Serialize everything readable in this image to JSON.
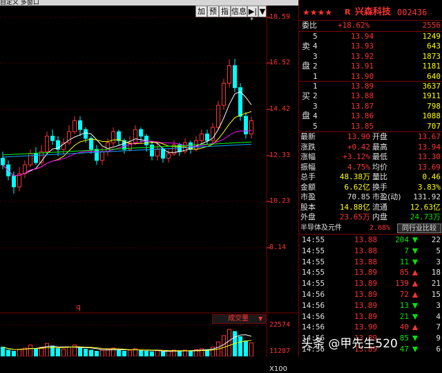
{
  "menu": {
    "text": "自定义  多窗口"
  },
  "toolbar": {
    "buttons": [
      "加",
      "预",
      "指",
      "信息",
      "▶|",
      "▼"
    ]
  },
  "chart": {
    "price_labels": [
      "18.59",
      "16.52",
      "14.42",
      "12.33",
      "10.23",
      "8.14"
    ],
    "q_marker": "q",
    "star_marker": "*",
    "volume_title": "成交量",
    "volume_labels": [
      "22574",
      "11287",
      "X100"
    ],
    "candles": [
      {
        "o": 12.2,
        "c": 11.9,
        "h": 12.5,
        "l": 11.7
      },
      {
        "o": 11.9,
        "c": 11.4,
        "h": 12.1,
        "l": 11.2
      },
      {
        "o": 11.4,
        "c": 10.9,
        "h": 11.6,
        "l": 10.6
      },
      {
        "o": 10.9,
        "c": 11.5,
        "h": 11.8,
        "l": 10.7
      },
      {
        "o": 11.5,
        "c": 11.9,
        "h": 12.1,
        "l": 11.3
      },
      {
        "o": 11.9,
        "c": 12.4,
        "h": 12.6,
        "l": 11.8
      },
      {
        "o": 12.4,
        "c": 12.0,
        "h": 12.7,
        "l": 11.9
      },
      {
        "o": 12.0,
        "c": 12.5,
        "h": 12.8,
        "l": 11.9
      },
      {
        "o": 12.5,
        "c": 13.2,
        "h": 13.4,
        "l": 12.4
      },
      {
        "o": 13.2,
        "c": 13.0,
        "h": 13.5,
        "l": 12.8
      },
      {
        "o": 13.0,
        "c": 12.6,
        "h": 13.2,
        "l": 12.3
      },
      {
        "o": 12.6,
        "c": 12.9,
        "h": 13.1,
        "l": 12.4
      },
      {
        "o": 12.9,
        "c": 13.4,
        "h": 13.7,
        "l": 12.8
      },
      {
        "o": 13.4,
        "c": 13.9,
        "h": 14.1,
        "l": 13.3
      },
      {
        "o": 13.9,
        "c": 13.5,
        "h": 14.1,
        "l": 13.2
      },
      {
        "o": 13.5,
        "c": 13.1,
        "h": 13.6,
        "l": 12.9
      },
      {
        "o": 13.1,
        "c": 12.6,
        "h": 13.2,
        "l": 12.4
      },
      {
        "o": 12.6,
        "c": 12.1,
        "h": 12.8,
        "l": 11.9
      },
      {
        "o": 12.1,
        "c": 12.5,
        "h": 12.7,
        "l": 11.9
      },
      {
        "o": 12.5,
        "c": 12.9,
        "h": 13.1,
        "l": 12.3
      },
      {
        "o": 12.9,
        "c": 13.4,
        "h": 13.6,
        "l": 12.7
      },
      {
        "o": 13.4,
        "c": 13.0,
        "h": 13.5,
        "l": 12.8
      },
      {
        "o": 13.0,
        "c": 12.6,
        "h": 13.1,
        "l": 12.4
      },
      {
        "o": 12.6,
        "c": 12.9,
        "h": 13.2,
        "l": 12.5
      },
      {
        "o": 12.9,
        "c": 13.5,
        "h": 13.7,
        "l": 12.8
      },
      {
        "o": 13.5,
        "c": 13.2,
        "h": 13.6,
        "l": 12.9
      },
      {
        "o": 13.2,
        "c": 12.8,
        "h": 13.3,
        "l": 12.5
      },
      {
        "o": 12.8,
        "c": 12.3,
        "h": 12.9,
        "l": 12.1
      },
      {
        "o": 12.3,
        "c": 12.6,
        "h": 12.9,
        "l": 12.1
      },
      {
        "o": 12.6,
        "c": 12.2,
        "h": 12.7,
        "l": 12.0
      },
      {
        "o": 12.2,
        "c": 12.4,
        "h": 12.6,
        "l": 12.0
      },
      {
        "o": 12.4,
        "c": 12.8,
        "h": 13.0,
        "l": 12.3
      },
      {
        "o": 12.8,
        "c": 12.5,
        "h": 12.9,
        "l": 12.3
      },
      {
        "o": 12.5,
        "c": 12.9,
        "h": 13.1,
        "l": 12.4
      },
      {
        "o": 12.9,
        "c": 12.6,
        "h": 13.0,
        "l": 12.4
      },
      {
        "o": 12.6,
        "c": 13.0,
        "h": 13.2,
        "l": 12.5
      },
      {
        "o": 13.0,
        "c": 13.3,
        "h": 13.5,
        "l": 12.8
      },
      {
        "o": 13.3,
        "c": 13.0,
        "h": 13.5,
        "l": 12.8
      },
      {
        "o": 13.0,
        "c": 13.6,
        "h": 13.8,
        "l": 12.9
      },
      {
        "o": 13.6,
        "c": 14.6,
        "h": 14.8,
        "l": 13.5
      },
      {
        "o": 14.6,
        "c": 15.6,
        "h": 15.8,
        "l": 14.4
      },
      {
        "o": 15.6,
        "c": 16.4,
        "h": 16.7,
        "l": 15.4
      },
      {
        "o": 16.4,
        "c": 15.4,
        "h": 16.7,
        "l": 15.2
      },
      {
        "o": 15.4,
        "c": 14.1,
        "h": 15.6,
        "l": 13.9
      },
      {
        "o": 14.1,
        "c": 13.3,
        "h": 14.3,
        "l": 13.1
      },
      {
        "o": 13.3,
        "c": 13.9,
        "h": 14.1,
        "l": 13.1
      }
    ],
    "volumes": [
      18,
      12,
      10,
      14,
      16,
      22,
      15,
      18,
      25,
      20,
      15,
      14,
      18,
      22,
      16,
      14,
      12,
      10,
      12,
      14,
      16,
      12,
      10,
      12,
      15,
      12,
      10,
      9,
      11,
      9,
      10,
      12,
      10,
      12,
      11,
      13,
      15,
      13,
      18,
      28,
      40,
      52,
      48,
      38,
      30,
      26
    ]
  },
  "stock": {
    "stars": "★★★★",
    "r_mark": "R",
    "name": "兴森科技",
    "code": "002436"
  },
  "order_book": {
    "webi_label": "委比",
    "webi_value": "+18.62%",
    "webi_diff": "2556",
    "sell_label_1": "卖",
    "sell_label_2": "盘",
    "buy_label_1": "买",
    "buy_label_2": "盘",
    "sells": [
      {
        "lvl": "5",
        "price": "13.94",
        "vol": "1249"
      },
      {
        "lvl": "4",
        "price": "13.93",
        "vol": "643"
      },
      {
        "lvl": "3",
        "price": "13.92",
        "vol": "1873"
      },
      {
        "lvl": "2",
        "price": "13.91",
        "vol": "1181"
      },
      {
        "lvl": "1",
        "price": "13.90",
        "vol": "640"
      }
    ],
    "buys": [
      {
        "lvl": "1",
        "price": "13.89",
        "vol": "3637"
      },
      {
        "lvl": "2",
        "price": "13.88",
        "vol": "1911"
      },
      {
        "lvl": "3",
        "price": "13.87",
        "vol": "798"
      },
      {
        "lvl": "4",
        "price": "13.86",
        "vol": "1088"
      },
      {
        "lvl": "5",
        "price": "13.85",
        "vol": "707"
      }
    ]
  },
  "stats": [
    {
      "l1": "最新",
      "v1": "13.90",
      "c1": "red",
      "l2": "开盘",
      "v2": "13.67",
      "c2": "red"
    },
    {
      "l1": "涨跌",
      "v1": "+0.42",
      "c1": "red",
      "l2": "最高",
      "v2": "13.94",
      "c2": "red"
    },
    {
      "l1": "涨幅",
      "v1": "+3.12%",
      "c1": "red",
      "l2": "最低",
      "v2": "13.30",
      "c2": "red"
    },
    {
      "l1": "振幅",
      "v1": "4.75%",
      "c1": "red",
      "l2": "均价",
      "v2": "13.69",
      "c2": "red"
    },
    {
      "l1": "总手",
      "v1": "48.38万",
      "c1": "yellow",
      "l2": "量比",
      "v2": "0.46",
      "c2": "yellow"
    },
    {
      "l1": "金额",
      "v1": "6.62亿",
      "c1": "yellow",
      "l2": "换手",
      "v2": "3.83%",
      "c2": "yellow"
    },
    {
      "l1": "市盈",
      "v1": "70.85",
      "c1": "white",
      "l2": "市盈(动)",
      "v2": "131.92",
      "c2": "white"
    },
    {
      "l1": "股本",
      "v1": "14.88亿",
      "c1": "yellow",
      "l2": "流通",
      "v2": "12.63亿",
      "c2": "yellow"
    },
    {
      "l1": "外盘",
      "v1": "23.65万",
      "c1": "red",
      "l2": "内盘",
      "v2": "24.73万",
      "c2": "green"
    }
  ],
  "industry": {
    "name": "半导体及元件",
    "change": "2.68%",
    "compare_button": "同行业比较"
  },
  "ticks": [
    {
      "time": "14:55",
      "price": "13.88",
      "pc": "red",
      "vol": "204",
      "vc": "green",
      "dir": "down",
      "n": "22"
    },
    {
      "time": "14:55",
      "price": "13.88",
      "pc": "red",
      "vol": "7",
      "vc": "green",
      "dir": "down",
      "n": "5"
    },
    {
      "time": "14:55",
      "price": "13.88",
      "pc": "red",
      "vol": "11",
      "vc": "green",
      "dir": "down",
      "n": "3"
    },
    {
      "time": "14:55",
      "price": "13.89",
      "pc": "red",
      "vol": "85",
      "vc": "red",
      "dir": "up",
      "n": "18"
    },
    {
      "time": "14:55",
      "price": "13.89",
      "pc": "red",
      "vol": "139",
      "vc": "red",
      "dir": "up",
      "n": "21"
    },
    {
      "time": "14:56",
      "price": "13.89",
      "pc": "red",
      "vol": "72",
      "vc": "red",
      "dir": "up",
      "n": "15"
    },
    {
      "time": "14:56",
      "price": "13.89",
      "pc": "red",
      "vol": "13",
      "vc": "green",
      "dir": "down",
      "n": "3"
    },
    {
      "time": "14:56",
      "price": "13.89",
      "pc": "red",
      "vol": "21",
      "vc": "green",
      "dir": "down",
      "n": "4"
    },
    {
      "time": "14:56",
      "price": "13.90",
      "pc": "red",
      "vol": "40",
      "vc": "red",
      "dir": "up",
      "n": "7"
    },
    {
      "time": "14:56",
      "price": "13.89",
      "pc": "red",
      "vol": "85",
      "vc": "green",
      "dir": "down",
      "n": "9"
    },
    {
      "time": "14:56",
      "price": "13.89",
      "pc": "red",
      "vol": "47",
      "vc": "green",
      "dir": "down",
      "n": "6"
    }
  ],
  "watermark": "头条 @甲先生520"
}
